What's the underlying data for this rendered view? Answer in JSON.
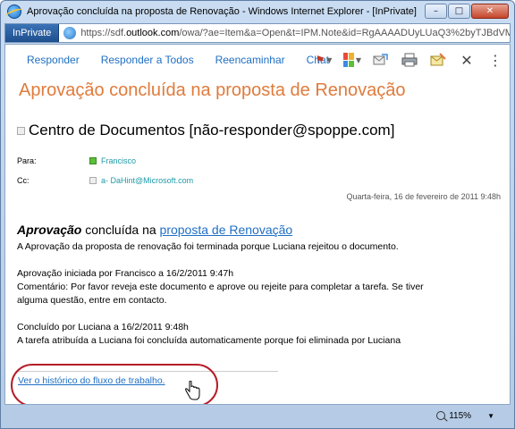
{
  "window": {
    "title": "Aprovação concluída na proposta de Renovação - Windows Internet Explorer - [InPrivate]",
    "controls": {
      "minimize": "–",
      "maximize": "□",
      "close": "✕"
    }
  },
  "addressbar": {
    "inprivate_label": "InPrivate",
    "url_prefix": "https://sdf.",
    "url_domain": "outlook.com",
    "url_rest": "/owa/?ae=Item&a=Open&t=IPM.Note&id=RgAAAADUyLUaQ3%2byTJBdVM"
  },
  "toolbar": {
    "reply": "Responder",
    "reply_all": "Responder a Todos",
    "forward": "Reencaminhar",
    "chat": "Chat",
    "icons": [
      "flag-icon",
      "categories-icon",
      "move-icon",
      "print-icon",
      "mark-icon",
      "delete-icon",
      "more-icon"
    ],
    "close_glyph": "✕",
    "more_glyph": "⋮"
  },
  "message": {
    "subject": "Aprovação concluída na proposta de Renovação",
    "from": "Centro de Documentos [não-responder@spoppe.com]",
    "to_label": "Para:",
    "to_value": "Francisco",
    "cc_label": "Cc:",
    "cc_value": "a- DaHint@Microsoft.com",
    "date": "Quarta-feira, 16 de fevereiro de 2011 9:48h",
    "heading_bold": "Aprovação",
    "heading_mid": " concluída na ",
    "heading_link": "proposta de Renovação",
    "line1": "A Aprovação da proposta de renovação foi terminada porque Luciana rejeitou o documento.",
    "line2": "Aprovação iniciada por Francisco a 16/2/2011 9:47h",
    "line3": "Comentário: Por favor reveja este documento e aprove ou rejeite para completar a tarefa. Se tiver",
    "line4": "alguma questão, entre em contacto.",
    "line5": "Concluído por Luciana a 16/2/2011 9:48h",
    "line6": "A tarefa atribuída a Luciana foi concluída automaticamente porque foi eliminada por Luciana",
    "history_link": "Ver o histórico do fluxo de trabalho."
  },
  "statusbar": {
    "zoom": "115%",
    "zoom_caret": "▼"
  },
  "colors": {
    "accent": "#1f6fc4",
    "subject": "#e07b3c",
    "callout": "#b51d2a"
  }
}
